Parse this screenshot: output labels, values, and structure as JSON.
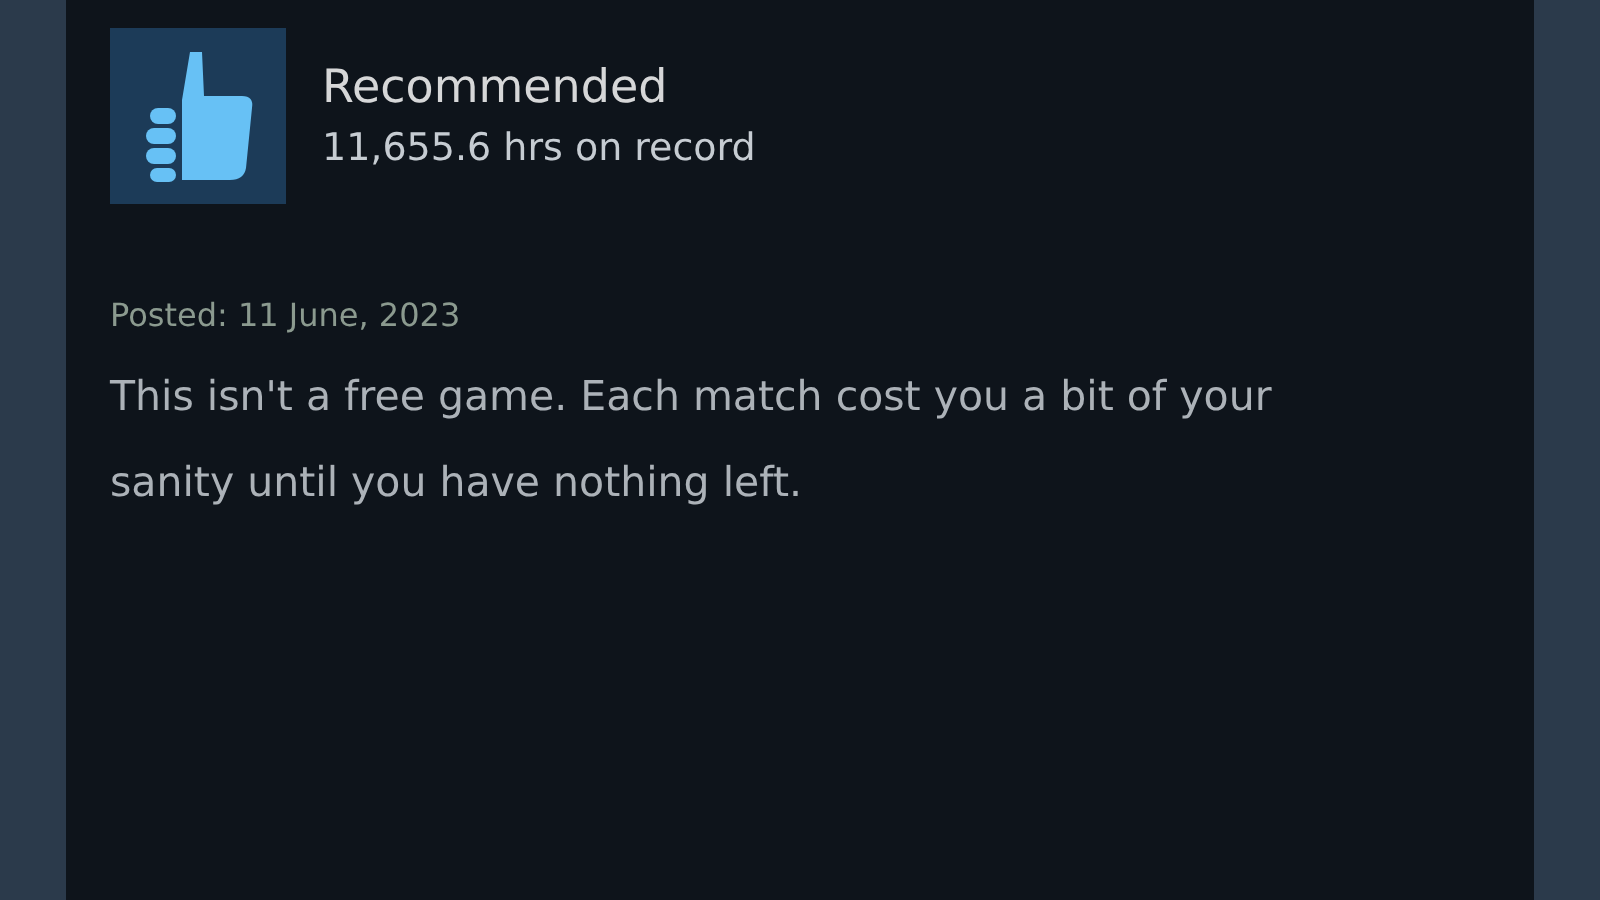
{
  "review": {
    "verdict": "Recommended",
    "hours": "11,655.6 hrs on record",
    "posted": "Posted: 11 June, 2023",
    "text": "This isn't a free game. Each match cost you a bit of your sanity until you have nothing left."
  }
}
